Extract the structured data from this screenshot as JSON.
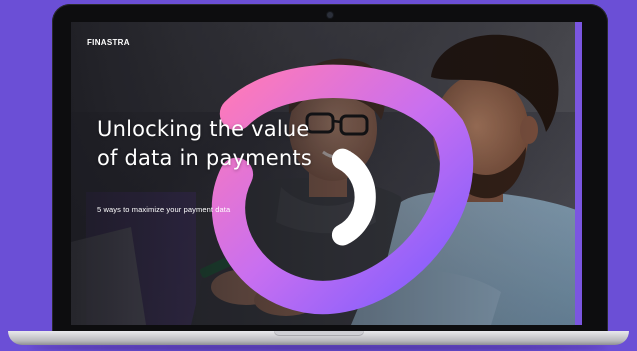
{
  "brand": {
    "name": "FINASTRA",
    "logo_icon": "finastra-logo-icon"
  },
  "hero": {
    "headline_line1": "Unlocking the value",
    "headline_line2": "of data in payments",
    "subtitle": "5 ways to maximize your payment data"
  },
  "colors": {
    "background": "#6b4fd6",
    "accent_strip": "#7b56e0",
    "text": "#ffffff"
  }
}
